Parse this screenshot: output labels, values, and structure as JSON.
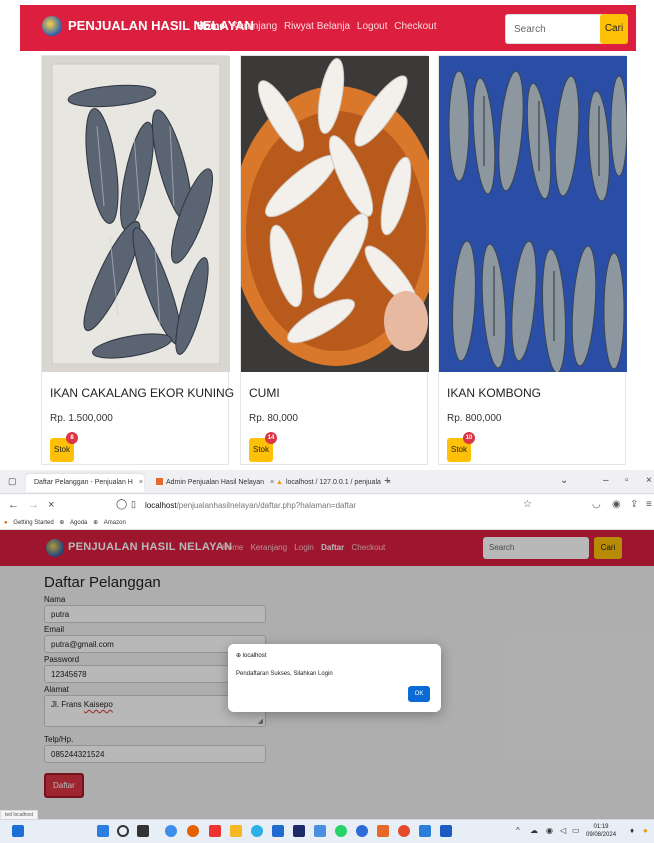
{
  "shop": {
    "brand": "PENJUALAN HASIL NELAYAN",
    "nav": [
      "Home",
      "Keranjang",
      "Riwyat Belanja",
      "Logout",
      "Checkout"
    ],
    "search_placeholder": "Search",
    "search_button": "Cari",
    "products": [
      {
        "name": "IKAN CAKALANG EKOR KUNING",
        "price": "Rp. 1.500,000",
        "stock_label": "Stok",
        "stock_count": "8"
      },
      {
        "name": "CUMI",
        "price": "Rp. 80,000",
        "stock_label": "Stok",
        "stock_count": "14"
      },
      {
        "name": "IKAN KOMBONG",
        "price": "Rp. 800,000",
        "stock_label": "Stok",
        "stock_count": "10"
      }
    ]
  },
  "browser": {
    "tabs": [
      {
        "title": "Daftar Pelanggan - Penjualan H"
      },
      {
        "title": "Admin Penjualan Hasil Nelayan"
      },
      {
        "title": "localhost / 127.0.0.1 / penjuala"
      }
    ],
    "url_host": "localhost",
    "url_path": "/penjualanhasilnelayan/daftar.php?halaman=daftar",
    "bookmarks": [
      "Getting Started",
      "Agoda",
      "Amazon"
    ],
    "status": "ted localhost"
  },
  "register": {
    "brand": "PENJUALAN HASIL NELAYAN",
    "nav": [
      "Home",
      "Keranjang",
      "Login",
      "Daftar",
      "Checkout"
    ],
    "search_placeholder": "Search",
    "search_button": "Cari",
    "title": "Daftar Pelanggan",
    "labels": {
      "name": "Nama",
      "email": "Email",
      "password": "Password",
      "address": "Alamat",
      "phone": "Telp/Hp."
    },
    "values": {
      "name": "putra",
      "email": "putra@gmail.com",
      "password": "12345678",
      "address_prefix": "Jl. Frans ",
      "address_spell": "Kaisepo",
      "phone": "085244321524"
    },
    "submit": "Daftar"
  },
  "dialog": {
    "host": "localhost",
    "message": "Pendaftaran Sukses, Silahkan Login",
    "ok": "OK"
  },
  "taskbar": {
    "time": "01:19",
    "date": "09/08/2024"
  }
}
